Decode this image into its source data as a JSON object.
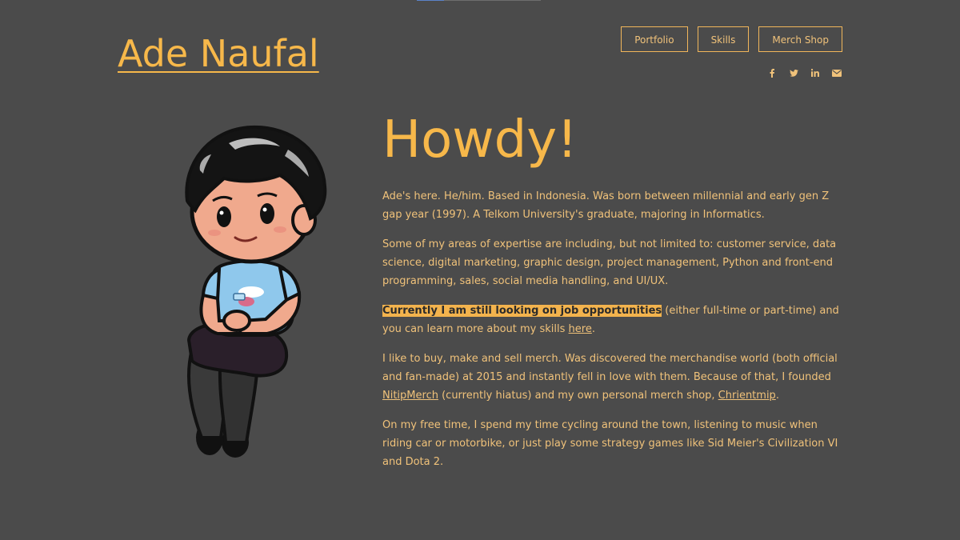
{
  "site": {
    "title": "Ade Naufal"
  },
  "nav": {
    "items": [
      "Portfolio",
      "Skills",
      "Merch Shop"
    ]
  },
  "social": {
    "icons": [
      "facebook-icon",
      "twitter-icon",
      "linkedin-icon",
      "email-icon"
    ]
  },
  "avatar": {
    "description": "chibi illustration of Ade Naufal"
  },
  "main": {
    "heading": "Howdy!",
    "p1": "Ade's here. He/him. Based in Indonesia. Was born between millennial and early gen Z gap year (1997). A Telkom University's graduate, majoring in Informatics.",
    "p2": "Some of my areas of expertise are including, but not limited to: customer service, data science, digital marketing, graphic design, project management, Python and front-end programming, sales, social media handling, and UI/UX.",
    "p3_highlight": "Currently I am still looking on job opportunities",
    "p3_text": " (either full-time or part-time) and you can learn more about my skills ",
    "p3_link": "here",
    "p3_end": ".",
    "p4_text": "I like to buy, make and sell merch. Was discovered the merchandise world (both official and fan-made) at 2015 and instantly fell in love with them. Because of that, I founded ",
    "p4_link1": "NitipMerch",
    "p4_mid": " (currently hiatus) and my own personal merch shop, ",
    "p4_link2": "Chrientmip",
    "p4_end": ".",
    "p5": "On my free time, I spend my time cycling around the town, listening to music when riding car or motorbike, or just play some strategy games like Sid Meier's Civilization VI and Dota 2."
  },
  "colors": {
    "background": "#4b4b4b",
    "accent": "#f7b84a",
    "text": "#f0c27a"
  }
}
